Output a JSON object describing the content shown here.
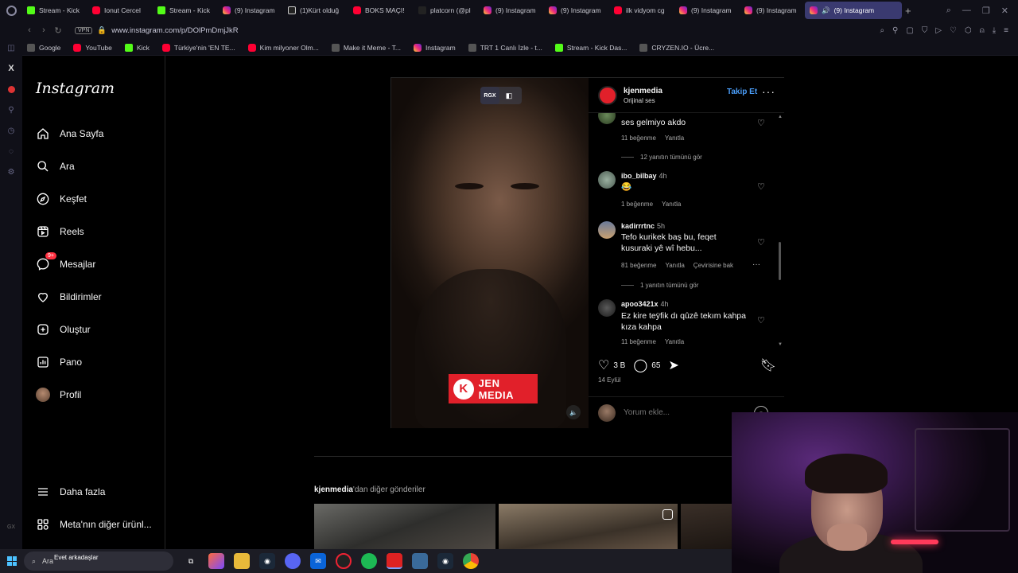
{
  "browser": {
    "tabs": [
      {
        "label": "Stream - Kick",
        "icon": "kick"
      },
      {
        "label": "Ionut Cercel",
        "icon": "yt"
      },
      {
        "label": "Stream - Kick",
        "icon": "kick"
      },
      {
        "label": "(9) Instagram",
        "icon": "ig"
      },
      {
        "label": "(1)Kürt olduğ",
        "icon": "tt"
      },
      {
        "label": "BOKS MAÇI! ",
        "icon": "yt"
      },
      {
        "label": "platcorn (@pl",
        "icon": "x"
      },
      {
        "label": "(9) Instagram",
        "icon": "ig"
      },
      {
        "label": "(9) Instagram",
        "icon": "ig"
      },
      {
        "label": "ilk vidyom cg",
        "icon": "yt"
      },
      {
        "label": "(9) Instagram",
        "icon": "ig"
      },
      {
        "label": "(9) Instagram",
        "icon": "ig"
      }
    ],
    "active_tab": "(9) Instagram",
    "vpn_label": "VPN",
    "url": "www.instagram.com/p/DOlPmDmjJkR",
    "bookmarks": [
      {
        "label": "Google",
        "icon": "gen"
      },
      {
        "label": "YouTube",
        "icon": "yt"
      },
      {
        "label": "Kick",
        "icon": "kick"
      },
      {
        "label": "Türkiye'nin 'EN TE...",
        "icon": "yt"
      },
      {
        "label": "Kim milyoner Olm...",
        "icon": "yt"
      },
      {
        "label": "Make it Meme - T...",
        "icon": "gen"
      },
      {
        "label": "Instagram",
        "icon": "ig"
      },
      {
        "label": "TRT 1 Canlı İzle - t...",
        "icon": "gen"
      },
      {
        "label": "Stream - Kick Das...",
        "icon": "kick"
      },
      {
        "label": "CRYZEN.IO - Ücre...",
        "icon": "gen"
      }
    ],
    "opera_gx": "GX"
  },
  "instagram": {
    "logo": "Instagram",
    "nav": [
      {
        "label": "Ana Sayfa",
        "icon": "home-icon"
      },
      {
        "label": "Ara",
        "icon": "search-icon"
      },
      {
        "label": "Keşfet",
        "icon": "compass-icon"
      },
      {
        "label": "Reels",
        "icon": "reels-icon"
      },
      {
        "label": "Mesajlar",
        "icon": "messenger-icon",
        "badge": "9+"
      },
      {
        "label": "Bildirimler",
        "icon": "heart-icon"
      },
      {
        "label": "Oluştur",
        "icon": "plus-square-icon"
      },
      {
        "label": "Pano",
        "icon": "dashboard-icon"
      },
      {
        "label": "Profil",
        "icon": "avatar"
      }
    ],
    "more_label": "Daha fazla",
    "meta_label": "Meta'nın diğer ürünl...",
    "post": {
      "video_badge": "RGX",
      "watermark": "JEN MEDIA",
      "username": "kjenmedia",
      "audio": "Orijinal ses",
      "follow_label": "Takip Et",
      "comments": [
        {
          "user": "",
          "time": "",
          "text": "ses gelmiyo akdo",
          "likes": "11 beğenme",
          "reply": "Yanıtla",
          "replies": "12 yanıtın tümünü gör"
        },
        {
          "user": "ibo_bilbay",
          "time": "4h",
          "text": "😂",
          "likes": "1 beğenme",
          "reply": "Yanıtla"
        },
        {
          "user": "kadirrrtnc",
          "time": "5h",
          "text": "Tefo kurikek baş bu, feqet kusuraki yê wî hebu...",
          "likes": "81 beğenme",
          "reply": "Yanıtla",
          "translate": "Çevirisine bak",
          "replies": "1 yanıtın tümünü gör"
        },
        {
          "user": "apoo3421x",
          "time": "4h",
          "text": "Ez kire teÿfik dı qûzê tekım kahpa kıza kahpa",
          "likes": "11 beğenme",
          "reply": "Yanıtla"
        }
      ],
      "likes_count": "3 B",
      "comments_count": "65",
      "date": "14 Eylül",
      "comment_placeholder": "Yorum ekle..."
    },
    "more_posts_user": "kjenmedia",
    "more_posts_suffix": "'dan diğer gönderiler"
  },
  "taskbar": {
    "search_placeholder": "Ara",
    "notification": "Evet arkadaşlar"
  }
}
